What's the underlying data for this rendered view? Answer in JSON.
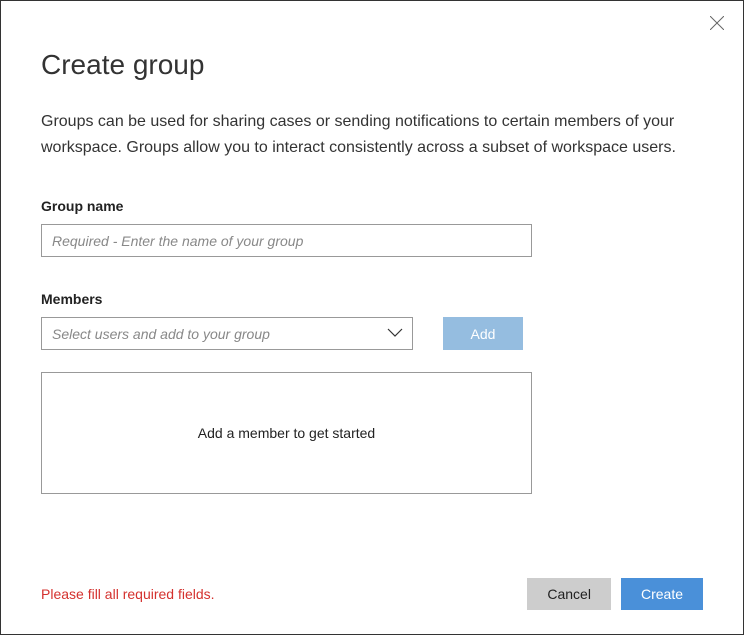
{
  "dialog": {
    "title": "Create group",
    "description": "Groups can be used for sharing cases or sending notifications to certain members of your workspace. Groups allow you to interact consistently across a subset of workspace users."
  },
  "groupName": {
    "label": "Group name",
    "placeholder": "Required - Enter the name of your group",
    "value": ""
  },
  "members": {
    "label": "Members",
    "selectPlaceholder": "Select users and add to your group",
    "addButton": "Add",
    "emptyText": "Add a member to get started"
  },
  "footer": {
    "errorMessage": "Please fill all required fields.",
    "cancelButton": "Cancel",
    "createButton": "Create"
  }
}
